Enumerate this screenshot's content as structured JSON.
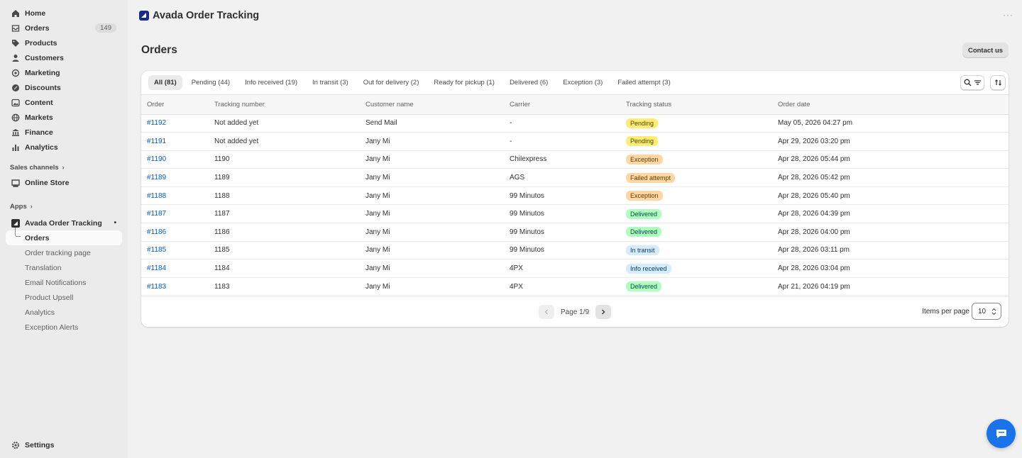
{
  "sidebar": {
    "items": [
      {
        "label": "Home",
        "icon": "home-icon"
      },
      {
        "label": "Orders",
        "icon": "orders-icon",
        "badge": "149"
      },
      {
        "label": "Products",
        "icon": "tag-icon"
      },
      {
        "label": "Customers",
        "icon": "person-icon"
      },
      {
        "label": "Marketing",
        "icon": "target-icon"
      },
      {
        "label": "Discounts",
        "icon": "discount-icon"
      },
      {
        "label": "Content",
        "icon": "content-icon"
      },
      {
        "label": "Markets",
        "icon": "globe-icon"
      },
      {
        "label": "Finance",
        "icon": "bank-icon"
      },
      {
        "label": "Analytics",
        "icon": "bar-chart-icon"
      }
    ],
    "sales_channels_label": "Sales channels",
    "online_store_label": "Online Store",
    "apps_label": "Apps",
    "app_name": "Avada Order Tracking",
    "app_subitems": [
      "Orders",
      "Order tracking page",
      "Translation",
      "Email Notifications",
      "Product Upsell",
      "Analytics",
      "Exception Alerts"
    ],
    "settings_label": "Settings"
  },
  "topbar": {
    "title": "Avada Order Tracking",
    "more": "···"
  },
  "page": {
    "title": "Orders",
    "contact_label": "Contact us"
  },
  "tabs": [
    "All (81)",
    "Pending (44)",
    "Info received (19)",
    "In transit (3)",
    "Out for delivery (2)",
    "Ready for pickup (1)",
    "Delivered (6)",
    "Exception (3)",
    "Failed attempt (3)"
  ],
  "table": {
    "columns": [
      "Order",
      "Tracking number",
      "Customer name",
      "Carrier",
      "Tracking status",
      "Order date"
    ],
    "rows": [
      {
        "order": "#1192",
        "tracking": "Not added yet",
        "customer": "Send Mail",
        "carrier": "-",
        "status": "Pending",
        "date": "May 05, 2026 04:27 pm"
      },
      {
        "order": "#1191",
        "tracking": "Not added yet",
        "customer": "Jany Mi",
        "carrier": "-",
        "status": "Pending",
        "date": "Apr 29, 2026 03:20 pm"
      },
      {
        "order": "#1190",
        "tracking": "1190",
        "customer": "Jany Mi",
        "carrier": "Chilexpress",
        "status": "Exception",
        "date": "Apr 28, 2026 05:44 pm"
      },
      {
        "order": "#1189",
        "tracking": "1189",
        "customer": "Jany Mi",
        "carrier": "AGS",
        "status": "Failed attempt",
        "date": "Apr 28, 2026 05:42 pm"
      },
      {
        "order": "#1188",
        "tracking": "1188",
        "customer": "Jany Mi",
        "carrier": "99 Minutos",
        "status": "Exception",
        "date": "Apr 28, 2026 05:40 pm"
      },
      {
        "order": "#1187",
        "tracking": "1187",
        "customer": "Jany Mi",
        "carrier": "99 Minutos",
        "status": "Delivered",
        "date": "Apr 28, 2026 04:39 pm"
      },
      {
        "order": "#1186",
        "tracking": "1186",
        "customer": "Jany Mi",
        "carrier": "99 Minutos",
        "status": "Delivered",
        "date": "Apr 28, 2026 04:00 pm"
      },
      {
        "order": "#1185",
        "tracking": "1185",
        "customer": "Jany Mi",
        "carrier": "99 Minutos",
        "status": "In transit",
        "date": "Apr 28, 2026 03:11 pm"
      },
      {
        "order": "#1184",
        "tracking": "1184",
        "customer": "Jany Mi",
        "carrier": "4PX",
        "status": "Info received",
        "date": "Apr 28, 2026 03:04 pm"
      },
      {
        "order": "#1183",
        "tracking": "1183",
        "customer": "Jany Mi",
        "carrier": "4PX",
        "status": "Delivered",
        "date": "Apr 21, 2026 04:19 pm"
      }
    ]
  },
  "status_colors": {
    "Pending": {
      "bg": "#ffeb78",
      "fg": "#4f4700"
    },
    "Exception": {
      "bg": "#ffd6a4",
      "fg": "#5e4200"
    },
    "Failed attempt": {
      "bg": "#ffd6a4",
      "fg": "#5e4200"
    },
    "Delivered": {
      "bg": "#affebf",
      "fg": "#014b40"
    },
    "In transit": {
      "bg": "#d5ebff",
      "fg": "#003a5a"
    },
    "Info received": {
      "bg": "#d5ebff",
      "fg": "#003a5a"
    }
  },
  "pagination": {
    "page_label": "Page 1/9",
    "items_per_page_label": "Items per page",
    "items_per_page_value": "10"
  },
  "colors": {
    "link": "#005bd3",
    "chat": "#1a73e8",
    "app_logo": "#1b2a8a"
  }
}
